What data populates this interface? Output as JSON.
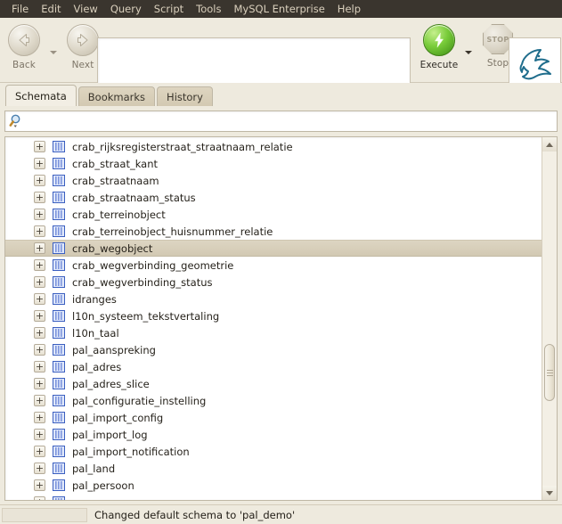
{
  "menubar": {
    "items": [
      {
        "label": "File"
      },
      {
        "label": "Edit"
      },
      {
        "label": "View"
      },
      {
        "label": "Query"
      },
      {
        "label": "Script"
      },
      {
        "label": "Tools"
      },
      {
        "label": "MySQL Enterprise"
      },
      {
        "label": "Help"
      }
    ]
  },
  "toolbar": {
    "back_label": "Back",
    "next_label": "Next",
    "execute_label": "Execute",
    "stop_label": "Stop",
    "stop_glyph_text": "STOP",
    "back_icon": "back-arrow-icon",
    "next_icon": "next-arrow-icon",
    "execute_icon": "lightning-bolt-icon",
    "stop_icon": "stop-octagon-icon",
    "logo_icon": "mysql-dolphin-logo",
    "query_editor_value": ""
  },
  "tabs": [
    {
      "label": "Schemata",
      "active": true
    },
    {
      "label": "Bookmarks",
      "active": false
    },
    {
      "label": "History",
      "active": false
    }
  ],
  "search": {
    "value": "",
    "placeholder": "",
    "icon": "search-magnifier-icon"
  },
  "tree": {
    "expander_symbol": "+",
    "items": [
      {
        "label": "crab_rijksregisterstraat_straatnaam_relatie",
        "selected": false
      },
      {
        "label": "crab_straat_kant",
        "selected": false
      },
      {
        "label": "crab_straatnaam",
        "selected": false
      },
      {
        "label": "crab_straatnaam_status",
        "selected": false
      },
      {
        "label": "crab_terreinobject",
        "selected": false
      },
      {
        "label": "crab_terreinobject_huisnummer_relatie",
        "selected": false
      },
      {
        "label": "crab_wegobject",
        "selected": true
      },
      {
        "label": "crab_wegverbinding_geometrie",
        "selected": false
      },
      {
        "label": "crab_wegverbinding_status",
        "selected": false
      },
      {
        "label": "idranges",
        "selected": false
      },
      {
        "label": "l10n_systeem_tekstvertaling",
        "selected": false
      },
      {
        "label": "l10n_taal",
        "selected": false
      },
      {
        "label": "pal_aanspreking",
        "selected": false
      },
      {
        "label": "pal_adres",
        "selected": false
      },
      {
        "label": "pal_adres_slice",
        "selected": false
      },
      {
        "label": "pal_configuratie_instelling",
        "selected": false
      },
      {
        "label": "pal_import_config",
        "selected": false
      },
      {
        "label": "pal_import_log",
        "selected": false
      },
      {
        "label": "pal_import_notification",
        "selected": false
      },
      {
        "label": "pal_land",
        "selected": false
      },
      {
        "label": "pal_persoon",
        "selected": false
      },
      {
        "label": "",
        "selected": false
      }
    ]
  },
  "scrollbar": {
    "up_icon": "scroll-up-arrow-icon",
    "down_icon": "scroll-down-arrow-icon"
  },
  "statusbar": {
    "message": "Changed default schema to 'pal_demo'"
  },
  "colors": {
    "menubar_bg": "#3a352e",
    "menubar_text": "#d9cfbc",
    "toolbar_bg": "#eeeade",
    "panel_bg": "#eeeade",
    "selection_bg": "#d8cfba",
    "schema_icon_blue": "#3b5fc0",
    "execute_green": "#79cc3a",
    "dolphin_teal": "#1f6d8c"
  }
}
